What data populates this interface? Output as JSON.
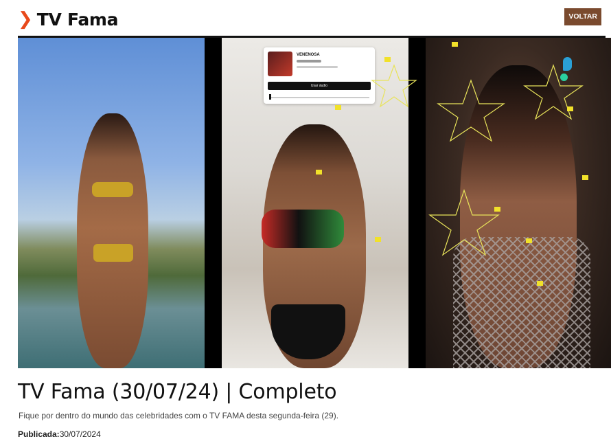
{
  "section": {
    "icon": "chevron-right-icon",
    "label": "TV Fama",
    "accent_color": "#e8491b"
  },
  "back_button": {
    "label": "VOLTAR",
    "color": "#7a4a2e"
  },
  "video": {
    "panels": [
      "panel-left",
      "panel-center",
      "panel-right"
    ],
    "overlay_card": {
      "song": "VENENOSA",
      "use_audio_label": "Usar áudio"
    },
    "logo_icon": "exclamation-logo-icon"
  },
  "article": {
    "title": "TV Fama (30/07/24) | Completo",
    "summary": "Fique por dentro do mundo das celebridades com o TV FAMA desta segunda-feira (29).",
    "published_label": "Publicada:",
    "published_date": "30/07/2024"
  }
}
